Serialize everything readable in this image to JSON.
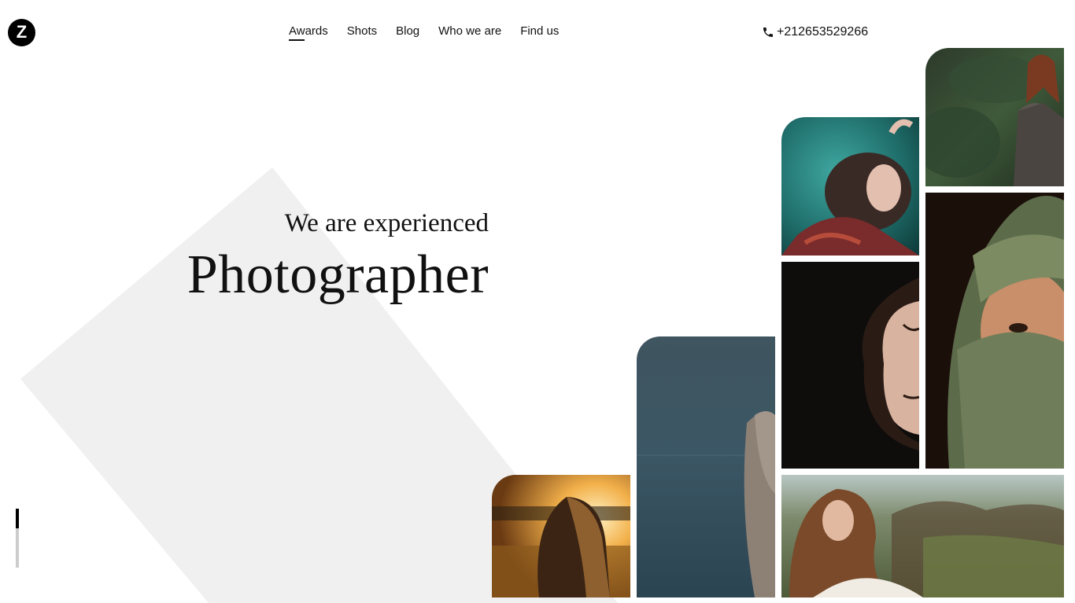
{
  "brand": {
    "logo_letter": "Z"
  },
  "nav": {
    "items": [
      {
        "label": "Awards",
        "active": true
      },
      {
        "label": "Shots",
        "active": false
      },
      {
        "label": "Blog",
        "active": false
      },
      {
        "label": "Who we are",
        "active": false
      },
      {
        "label": "Find us",
        "active": false
      }
    ]
  },
  "contact": {
    "phone": "+212653529266",
    "icon": "phone-icon"
  },
  "hero": {
    "subtitle": "We are experienced",
    "title": "Photographer"
  },
  "gallery": {
    "photos": [
      {
        "name": "photo-woman-forest"
      },
      {
        "name": "photo-woman-water"
      },
      {
        "name": "photo-woman-scarf"
      },
      {
        "name": "photo-woman-dark-profile"
      },
      {
        "name": "photo-woman-sea"
      },
      {
        "name": "photo-woman-sunset"
      },
      {
        "name": "photo-woman-field"
      }
    ]
  },
  "colors": {
    "background": "#ffffff",
    "shape": "#f0f0f0",
    "text": "#111111",
    "accent": "#000000"
  }
}
